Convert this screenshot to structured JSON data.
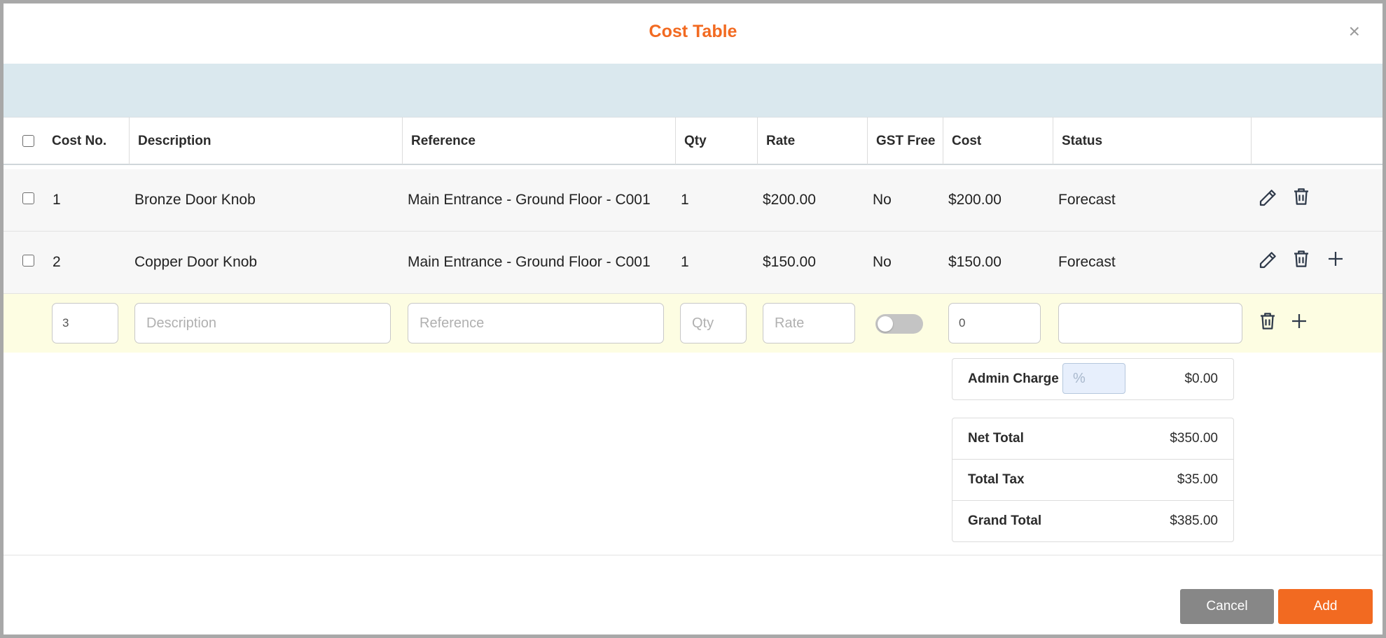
{
  "modal": {
    "title": "Cost Table",
    "close_glyph": "×"
  },
  "table": {
    "columns": [
      "Cost No.",
      "Description",
      "Reference",
      "Qty",
      "Rate",
      "GST Free",
      "Cost",
      "Status"
    ],
    "rows": [
      {
        "cost_no": "1",
        "description": "Bronze Door Knob",
        "reference": "Main Entrance - Ground Floor - C001",
        "qty": "1",
        "rate": "$200.00",
        "gst_free": "No",
        "cost": "$200.00",
        "status": "Forecast",
        "actions": [
          "pencil-icon",
          "trash-icon"
        ]
      },
      {
        "cost_no": "2",
        "description": "Copper Door Knob",
        "reference": "Main Entrance - Ground Floor - C001",
        "qty": "1",
        "rate": "$150.00",
        "gst_free": "No",
        "cost": "$150.00",
        "status": "Forecast",
        "actions": [
          "pencil-icon",
          "trash-icon",
          "plus-icon"
        ]
      }
    ],
    "new_row": {
      "cost_no_value": "3",
      "description_placeholder": "Description",
      "reference_placeholder": "Reference",
      "qty_placeholder": "Qty",
      "rate_placeholder": "Rate",
      "gst_free_on": false,
      "cost_value": "0",
      "status_value": "",
      "actions": [
        "trash-icon",
        "plus-icon"
      ]
    }
  },
  "summary": {
    "admin_charge_label": "Admin Charge",
    "admin_charge_placeholder": "%",
    "admin_charge_amount": "$0.00",
    "net_total_label": "Net Total",
    "net_total_value": "$350.00",
    "total_tax_label": "Total Tax",
    "total_tax_value": "$35.00",
    "grand_total_label": "Grand Total",
    "grand_total_value": "$385.00"
  },
  "footer": {
    "cancel_label": "Cancel",
    "add_label": "Add"
  },
  "colors": {
    "accent": "#f26a21",
    "toolbar_band": "#dae8ee",
    "new_row_bg": "#fdfde2",
    "cancel_button": "#878787"
  }
}
